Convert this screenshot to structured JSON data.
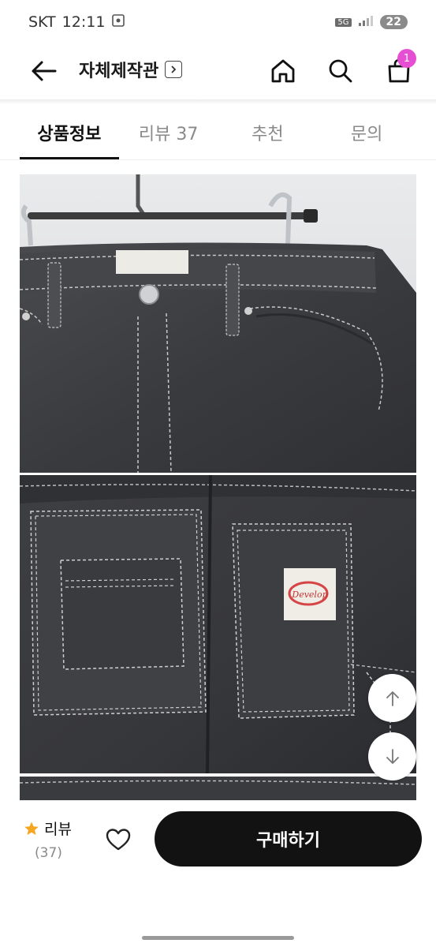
{
  "status_bar": {
    "carrier": "SKT",
    "time": "12:11",
    "network": "5G",
    "battery": "22"
  },
  "header": {
    "shop_name": "자체제작관",
    "cart_count": "1"
  },
  "tabs": [
    {
      "label": "상품정보",
      "active": true
    },
    {
      "label": "리뷰 37",
      "active": false
    },
    {
      "label": "추천",
      "active": false
    },
    {
      "label": "문의",
      "active": false
    }
  ],
  "photos": {
    "patch_text": "Develop"
  },
  "bottom_bar": {
    "review_label": "리뷰",
    "review_count": "(37)",
    "buy_label": "구매하기"
  },
  "colors": {
    "accent_badge": "#e64fd3",
    "buy_button": "#121212",
    "star": "#f5a623"
  }
}
